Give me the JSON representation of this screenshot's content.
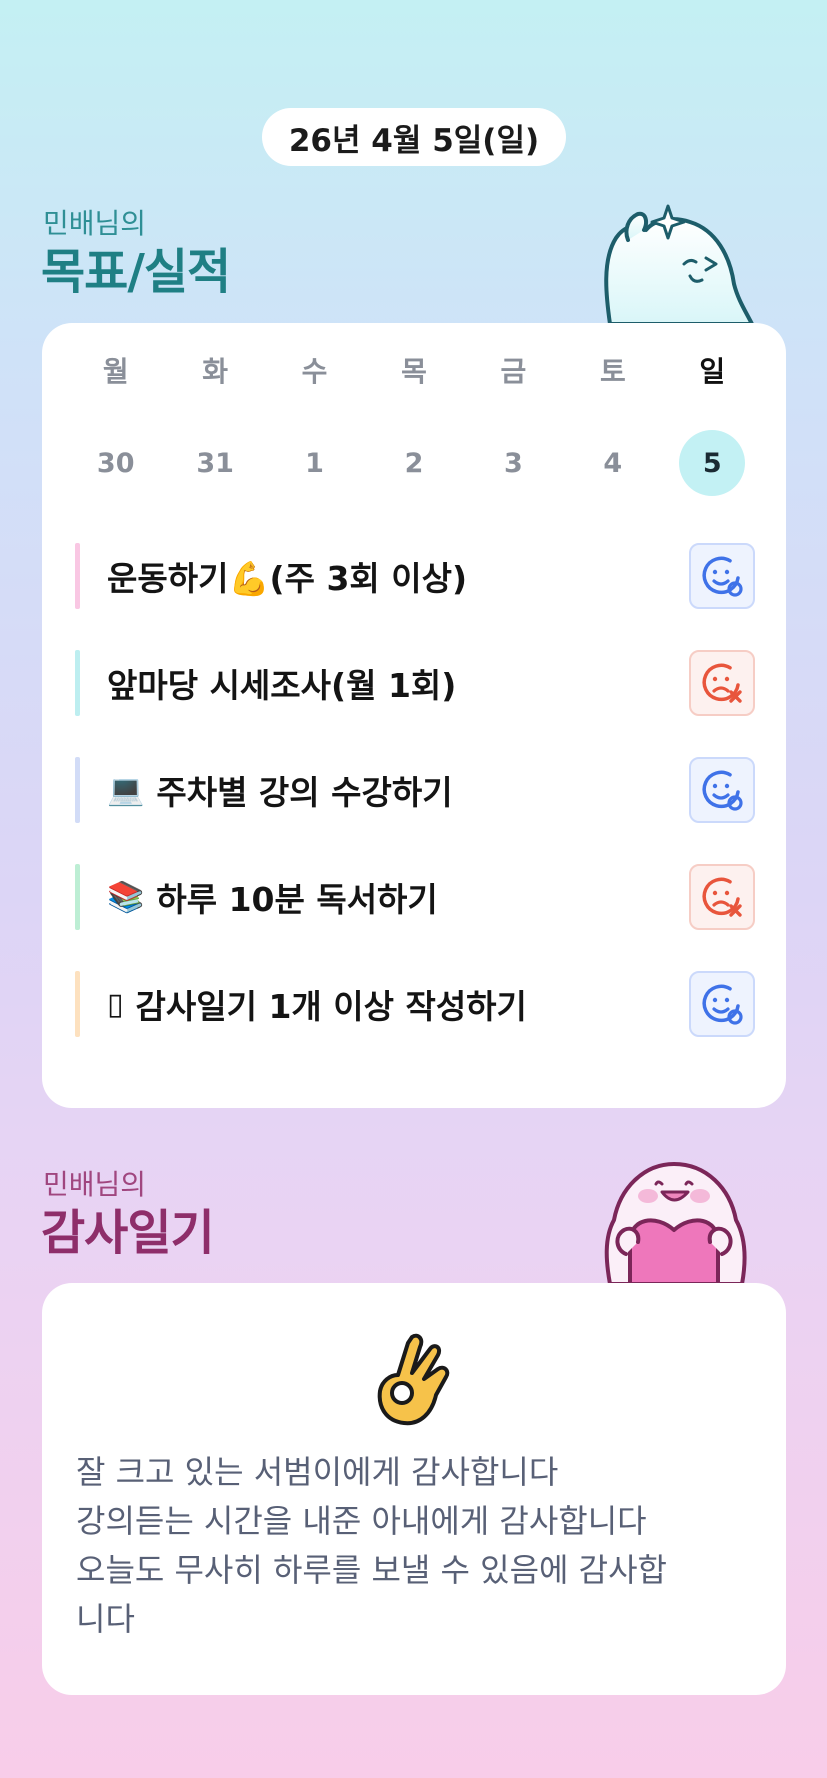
{
  "header": {
    "date": "26년 4월 5일(일)"
  },
  "goals_section": {
    "owner": "민배님의",
    "title": "목표/실적"
  },
  "week": {
    "days": [
      "월",
      "화",
      "수",
      "목",
      "금",
      "토",
      "일"
    ],
    "dates": [
      "30",
      "31",
      "1",
      "2",
      "3",
      "4",
      "5"
    ],
    "selected_index": 6
  },
  "goals": [
    {
      "emoji": "",
      "label": "운동하기💪(주 3회 이상)",
      "status": "done",
      "color": "#f9c7e3"
    },
    {
      "emoji": "",
      "label": "앞마당 시세조사(월 1회)",
      "status": "failed",
      "color": "#bdeef0"
    },
    {
      "emoji": "💻",
      "label": "주차별 강의 수강하기",
      "status": "done",
      "color": "#d2dcf7"
    },
    {
      "emoji": "📚",
      "label": "하루 10분 독서하기",
      "status": "failed",
      "color": "#bdeed4"
    },
    {
      "emoji": "▯",
      "label": "감사일기 1개 이상 작성하기",
      "status": "done",
      "color": "#fde1bf"
    }
  ],
  "diary_section": {
    "owner": "민배님의",
    "title": "감사일기"
  },
  "diary": {
    "emoji": "ok-hand",
    "text": "잘 크고 있는 서범이에게 감사합니다\n강의듣는 시간을 내준 아내에게 감사합니다\n오늘도 무사히 하루를 보낼 수 있음에 감사합\n니다"
  },
  "colors": {
    "ok_icon": "#3f72e8",
    "fail_icon": "#e8553c",
    "goal_title": "#1f7f84",
    "diary_title": "#8e2e6a"
  }
}
